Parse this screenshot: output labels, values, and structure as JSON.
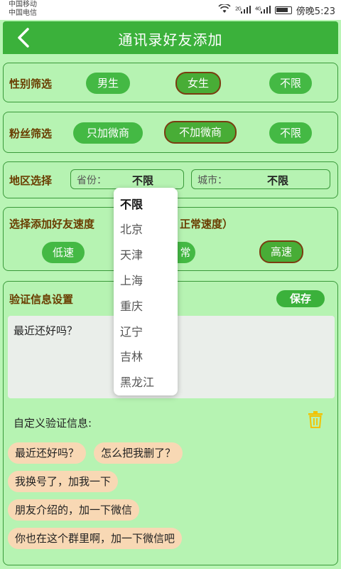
{
  "status_bar": {
    "carrier1": "中国移动",
    "carrier2": "中国电信",
    "signal1_label": "2G",
    "signal2_label": "4G",
    "time": "傍晚5:23"
  },
  "nav": {
    "back_label": "<",
    "title": "通讯录好友添加"
  },
  "gender": {
    "label": "性别筛选",
    "options": [
      "男生",
      "女生",
      "不限"
    ],
    "selected": "女生"
  },
  "fans": {
    "label": "粉丝筛选",
    "options": [
      "只加微商",
      "不加微商",
      "不限"
    ],
    "selected": "不加微商"
  },
  "region": {
    "label": "地区选择",
    "province_label": "省份：",
    "province_value": "不限",
    "city_label": "城市：",
    "city_value": "不限"
  },
  "speed": {
    "label_left": "选择添加好友速度",
    "label_right": "正常速度）",
    "options": [
      "低速",
      "常",
      "高速"
    ],
    "selected": "高速"
  },
  "verify": {
    "label": "验证信息设置",
    "save_label": "保存",
    "text": "最近还好吗？",
    "custom_label": "自定义验证信息:",
    "presets": [
      "最近还好吗？",
      "怎么把我删了？",
      "我换号了，加我一下",
      "朋友介绍的，加一下微信",
      "你也在这个群里啊，加一下微信吧"
    ]
  },
  "province_dropdown": {
    "options": [
      "不限",
      "北京",
      "天津",
      "上海",
      "重庆",
      "辽宁",
      "吉林",
      "黑龙江"
    ],
    "selected": "不限"
  },
  "colors": {
    "background": "#b9f5b5",
    "primary_green": "#3bb13b",
    "label_brown": "#6a3d00",
    "chip_bg": "#f8d8b4",
    "trash_yellow": "#f2c200"
  }
}
